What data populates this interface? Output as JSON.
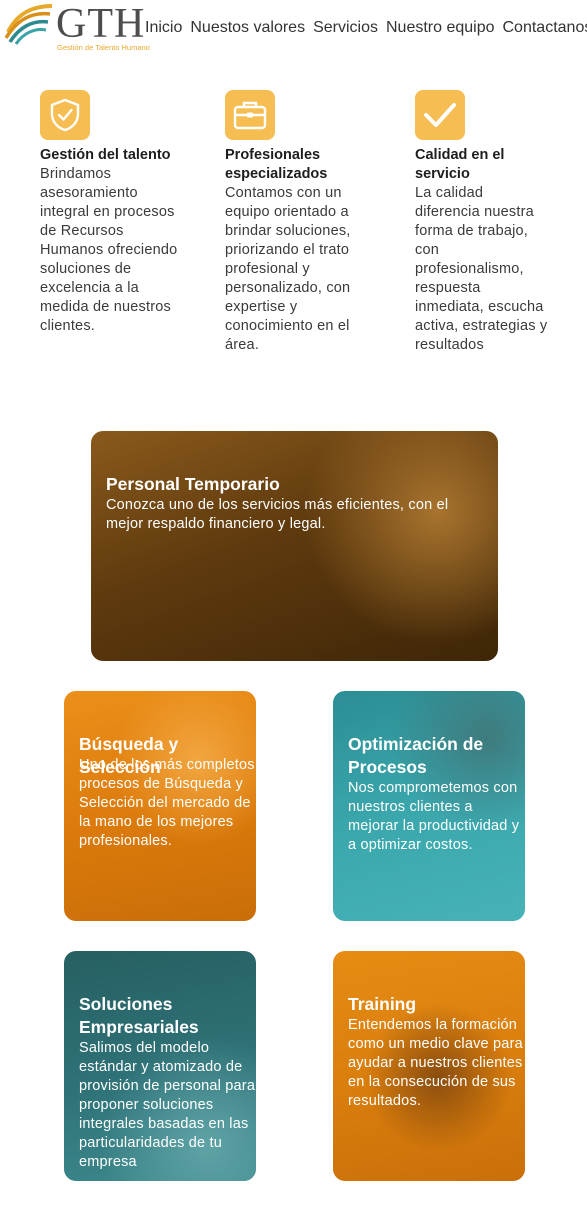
{
  "header": {
    "logo": {
      "text": "GTH",
      "subtitle": "Gestión de Talento Humano"
    },
    "nav": [
      "Inicio",
      "Nuestos valores",
      "Servicios",
      "Nuestro equipo",
      "Contactanos"
    ]
  },
  "features": [
    {
      "icon": "shield-check-icon",
      "title": "Gestión del talento",
      "text": "Brindamos asesoramiento integral en procesos de Recursos Humanos ofreciendo soluciones de excelencia a la medida de nuestros clientes."
    },
    {
      "icon": "briefcase-icon",
      "title": "Profesionales especializados",
      "text": "Contamos con un equipo orientado a brindar soluciones, priorizando el trato profesional y personalizado, con expertise y conocimiento en el área."
    },
    {
      "icon": "checkmark-icon",
      "title": "Calidad en el servicio",
      "text": "La calidad diferencia nuestra forma de trabajo, con profesionalismo, respuesta inmediata, escucha activa, estrategias y resultados"
    }
  ],
  "services": [
    {
      "title": "Personal Temporario",
      "text": "Conozca uno de los servicios más eficientes, con el mejor respaldo financiero y legal.",
      "color": "#7a4a12"
    },
    {
      "title": "Búsqueda y Selección",
      "text": "Uno de los más completos procesos de Búsqueda y Selección del mercado de la mano de los mejores profesionales.",
      "color": "#e88a12"
    },
    {
      "title": "Optimización de Procesos",
      "text": "Nos comprometemos con nuestros clientes a mejorar la productividad y a optimizar costos.",
      "color": "#2f9aa0"
    },
    {
      "title": "Soluciones Empresariales",
      "text": "Salimos del modelo estándar y atomizado de provisión de personal para proponer soluciones integrales basadas en las particularidades de tu empresa",
      "color": "#2a6f73"
    },
    {
      "title": "Training",
      "text": "Entendemos la formación como un medio clave para ayudar a nuestros clientes en la consecución de sus resultados.",
      "color": "#e0870f"
    }
  ],
  "colors": {
    "accent": "#f5bd52",
    "nav_text": "#333333"
  }
}
